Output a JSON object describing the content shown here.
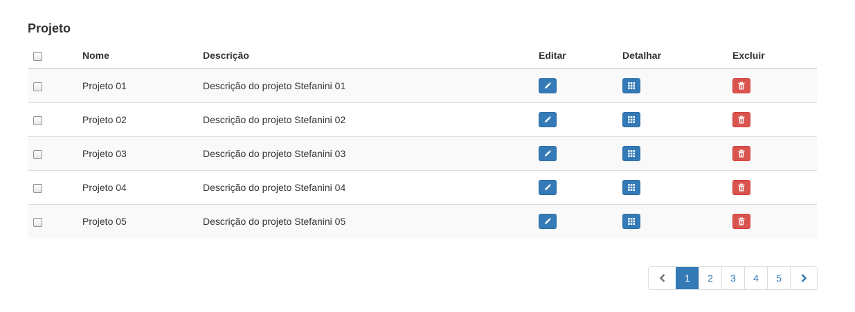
{
  "title": "Projeto",
  "table": {
    "headers": {
      "nome": "Nome",
      "descricao": "Descrição",
      "editar": "Editar",
      "detalhar": "Detalhar",
      "excluir": "Excluir"
    },
    "rows": [
      {
        "nome": "Projeto 01",
        "descricao": "Descrição do projeto Stefanini 01"
      },
      {
        "nome": "Projeto 02",
        "descricao": "Descrição do projeto Stefanini 02"
      },
      {
        "nome": "Projeto 03",
        "descricao": "Descrição do projeto Stefanini 03"
      },
      {
        "nome": "Projeto 04",
        "descricao": "Descrição do projeto Stefanini 04"
      },
      {
        "nome": "Projeto 05",
        "descricao": "Descrição do projeto Stefanini 05"
      }
    ],
    "row_icons": {
      "edit": "pencil-icon",
      "detail": "grid-icon",
      "delete": "trash-icon"
    }
  },
  "pagination": {
    "prev_icon": "chevron-left-icon",
    "next_icon": "chevron-right-icon",
    "pages": [
      "1",
      "2",
      "3",
      "4",
      "5"
    ],
    "active_page": "1"
  },
  "colors": {
    "primary": "#337ab7",
    "danger": "#d9534f",
    "row_stripe": "#f9f9f9",
    "border": "#dddddd"
  }
}
